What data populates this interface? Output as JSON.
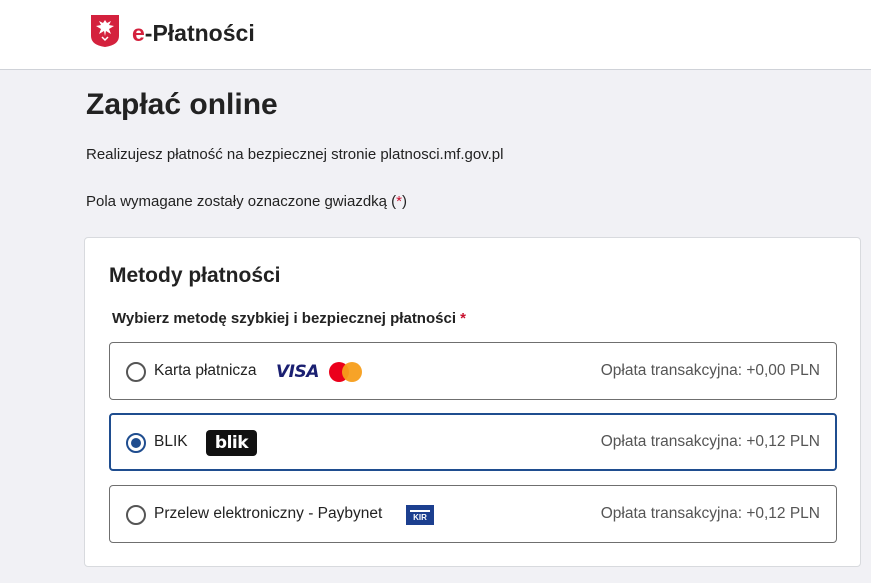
{
  "header": {
    "brand_prefix": "e",
    "brand_rest": "-Płatności",
    "emblem_icon": "polish-eagle-icon"
  },
  "page": {
    "title": "Zapłać online",
    "info": "Realizujesz płatność na bezpiecznej stronie platnosci.mf.gov.pl",
    "required_note": "Pola wymagane zostały oznaczone gwiazdką (",
    "required_star": "*",
    "required_close": ")"
  },
  "methods": {
    "title": "Metody płatności",
    "subtitle": "Wybierz metodę szybkiej i bezpiecznej płatności",
    "subtitle_star": "*",
    "options": [
      {
        "label": "Karta płatnicza",
        "fee": "Opłata transakcyjna: +0,00 PLN",
        "selected": false,
        "logo_text": "VISA"
      },
      {
        "label": "BLIK",
        "fee": "Opłata transakcyjna: +0,12 PLN",
        "selected": true,
        "logo_text": "blik"
      },
      {
        "label": "Przelew elektroniczny - Paybynet",
        "fee": "Opłata transakcyjna: +0,12 PLN",
        "selected": false,
        "logo_text": "KIR"
      }
    ]
  },
  "colors": {
    "accent_red": "#d4213d",
    "selected_blue": "#1f4d8f",
    "visa_blue": "#1a1f71"
  }
}
